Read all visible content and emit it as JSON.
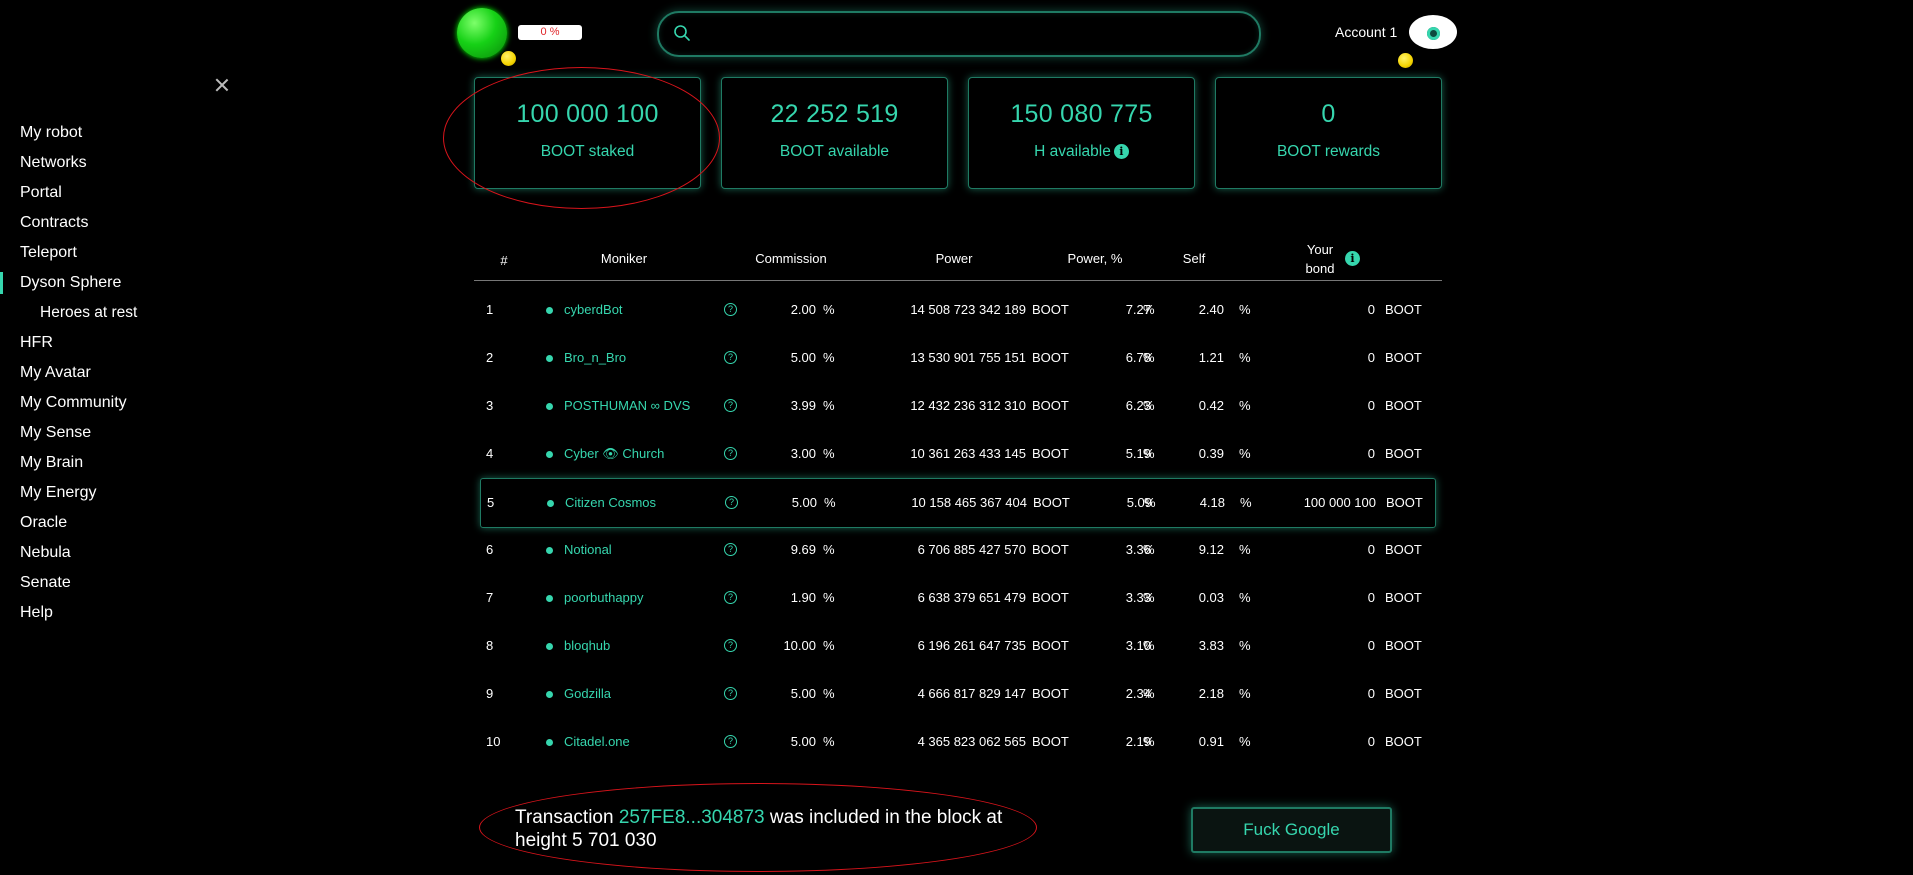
{
  "sidebar": {
    "items": [
      {
        "label": "My robot"
      },
      {
        "label": "Networks"
      },
      {
        "label": "Portal"
      },
      {
        "label": "Contracts"
      },
      {
        "label": "Teleport"
      },
      {
        "label": "Dyson Sphere",
        "active": true
      },
      {
        "label": "Heroes at rest",
        "sub": true
      },
      {
        "label": "HFR"
      },
      {
        "label": "My Avatar"
      },
      {
        "label": "My Community"
      },
      {
        "label": "My Sense"
      },
      {
        "label": "My Brain"
      },
      {
        "label": "My Energy"
      },
      {
        "label": "Oracle"
      },
      {
        "label": "Nebula"
      },
      {
        "label": "Senate"
      },
      {
        "label": "Help"
      }
    ]
  },
  "header": {
    "progress": "0 %",
    "progress_value": 0,
    "search": {
      "value": "",
      "placeholder": ""
    },
    "account_name": "Account 1"
  },
  "stats": [
    {
      "value": "100 000 100",
      "label": "BOOT staked"
    },
    {
      "value": "22 252 519",
      "label": "BOOT available"
    },
    {
      "value": "150 080 775",
      "label": "H available",
      "info": true
    },
    {
      "value": "0",
      "label": "BOOT rewards"
    }
  ],
  "table": {
    "headers": {
      "num": "#",
      "moniker": "Moniker",
      "commission": "Commission",
      "power": "Power",
      "power_pct": "Power, %",
      "self": "Self",
      "bond_line1": "Your",
      "bond_line2": "bond"
    },
    "rows": [
      {
        "n": "1",
        "moniker": "cyberdBot",
        "commission": "2.00",
        "power": "14 508 723 342 189",
        "power_pct": "7.27",
        "self": "2.40",
        "bond": "0"
      },
      {
        "n": "2",
        "moniker": "Bro_n_Bro",
        "commission": "5.00",
        "power": "13 530 901 755 151",
        "power_pct": "6.78",
        "self": "1.21",
        "bond": "0"
      },
      {
        "n": "3",
        "moniker": "POSTHUMAN ∞ DVS",
        "commission": "3.99",
        "power": "12 432 236 312 310",
        "power_pct": "6.23",
        "self": "0.42",
        "bond": "0"
      },
      {
        "n": "4",
        "moniker": "Cyber 👁 Church",
        "commission": "3.00",
        "power": "10 361 263 433 145",
        "power_pct": "5.19",
        "self": "0.39",
        "bond": "0"
      },
      {
        "n": "5",
        "moniker": "Citizen Cosmos",
        "commission": "5.00",
        "power": "10 158 465 367 404",
        "power_pct": "5.09",
        "self": "4.18",
        "bond": "100 000 100",
        "highlight": true
      },
      {
        "n": "6",
        "moniker": "Notional",
        "commission": "9.69",
        "power": "6 706 885 427 570",
        "power_pct": "3.36",
        "self": "9.12",
        "bond": "0"
      },
      {
        "n": "7",
        "moniker": "poorbuthappy",
        "commission": "1.90",
        "power": "6 638 379 651 479",
        "power_pct": "3.33",
        "self": "0.03",
        "bond": "0"
      },
      {
        "n": "8",
        "moniker": "bloqhub",
        "commission": "10.00",
        "power": "6 196 261 647 735",
        "power_pct": "3.10",
        "self": "3.83",
        "bond": "0"
      },
      {
        "n": "9",
        "moniker": "Godzilla",
        "commission": "5.00",
        "power": "4 666 817 829 147",
        "power_pct": "2.34",
        "self": "2.18",
        "bond": "0"
      },
      {
        "n": "10",
        "moniker": "Citadel.one",
        "commission": "5.00",
        "power": "4 365 823 062 565",
        "power_pct": "2.19",
        "self": "0.91",
        "bond": "0"
      }
    ],
    "pct_unit": "%",
    "token_unit": "BOOT",
    "question_mark": "?"
  },
  "footer": {
    "tx_prefix": "Transaction ",
    "tx_hash": "257FE8...304873",
    "tx_suffix": " was included in the block at height 5 701 030",
    "action_button": "Fuck Google"
  },
  "colors": {
    "accent": "#36d6ae",
    "border": "#1f7a63",
    "annotation": "#d8141b",
    "background": "#000000"
  },
  "icons": [
    "close-icon",
    "search-icon",
    "eye-icon",
    "info-icon",
    "question-icon"
  ]
}
